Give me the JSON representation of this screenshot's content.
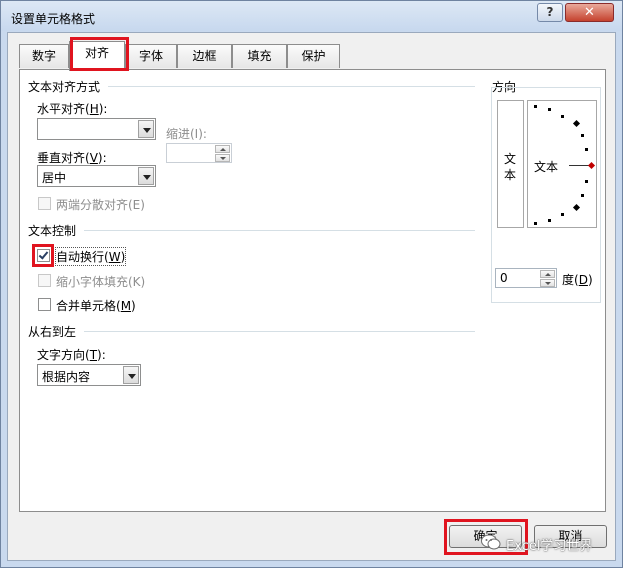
{
  "window": {
    "title": "设置单元格格式",
    "help_label": "?",
    "close_label": "✕"
  },
  "tabs": [
    {
      "label": "数字",
      "active": false
    },
    {
      "label": "对齐",
      "active": true
    },
    {
      "label": "字体",
      "active": false
    },
    {
      "label": "边框",
      "active": false
    },
    {
      "label": "填充",
      "active": false
    },
    {
      "label": "保护",
      "active": false
    }
  ],
  "text_alignment": {
    "section_title": "文本对齐方式",
    "horizontal": {
      "label": "水平对齐(",
      "hotkey": "H",
      "label_end": "):",
      "value": ""
    },
    "indent": {
      "label": "缩进(I):",
      "value": ""
    },
    "vertical": {
      "label": "垂直对齐(",
      "hotkey": "V",
      "label_end": "):",
      "value": "居中"
    },
    "justify_distributed": {
      "label": "两端分散对齐(E)",
      "checked": false,
      "enabled": false
    }
  },
  "orientation": {
    "section_title": "方向",
    "vertical_text": "文本",
    "dial_text": "文本",
    "degrees_value": "0",
    "degrees_label": "度(",
    "degrees_hotkey": "D",
    "degrees_label_end": ")"
  },
  "text_control": {
    "section_title": "文本控制",
    "wrap_text": {
      "label": "自动换行(",
      "hotkey": "W",
      "label_end": ")",
      "checked": true,
      "enabled": true
    },
    "shrink_to_fit": {
      "label": "缩小字体填充(K)",
      "checked": false,
      "enabled": false
    },
    "merge_cells": {
      "label": "合并单元格(",
      "hotkey": "M",
      "label_end": ")",
      "checked": false,
      "enabled": true
    }
  },
  "rtl": {
    "section_title": "从右到左",
    "direction": {
      "label": "文字方向(",
      "hotkey": "T",
      "label_end": "):",
      "value": "根据内容"
    }
  },
  "footer": {
    "ok_label": "确定",
    "cancel_label": "取消"
  },
  "watermark": {
    "text": "Excel学习世界"
  },
  "colors": {
    "highlight": "#e0141f",
    "dialog_frame": "#c9d9ee",
    "angle_marker": "#c00000"
  }
}
